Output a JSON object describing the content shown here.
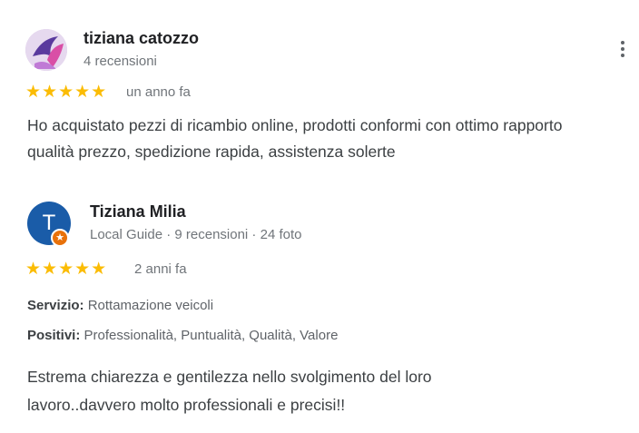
{
  "reviews": [
    {
      "author": "tiziana catozzo",
      "meta": "4 recensioni",
      "stars": "★★★★★",
      "rating": 5,
      "when": "un anno fa",
      "text": "Ho acquistato pezzi di ricambio online, prodotti conformi con ottimo rapporto qualità prezzo, spedizione rapida, assistenza solerte"
    },
    {
      "author": "Tiziana Milia",
      "avatar_letter": "T",
      "meta": "Local Guide · 9 recensioni · 24 foto",
      "stars": "★★★★★",
      "rating": 5,
      "when": "2 anni fa",
      "service_label": "Servizio:",
      "service_value": " Rottamazione veicoli",
      "positives_label": "Positivi:",
      "positives_value": " Professionalità, Puntualità, Qualità, Valore",
      "text": "Estrema chiarezza e gentilezza nello svolgimento del loro lavoro..davvero molto professionali e precisi!!"
    }
  ],
  "icons": {
    "more": "more-vert-icon",
    "star": "star-icon",
    "local_guide_badge": "local-guide-badge-icon"
  },
  "colors": {
    "star": "#fbbc04",
    "avatar2_bg": "#1a5ca8",
    "badge": "#e8710a"
  }
}
